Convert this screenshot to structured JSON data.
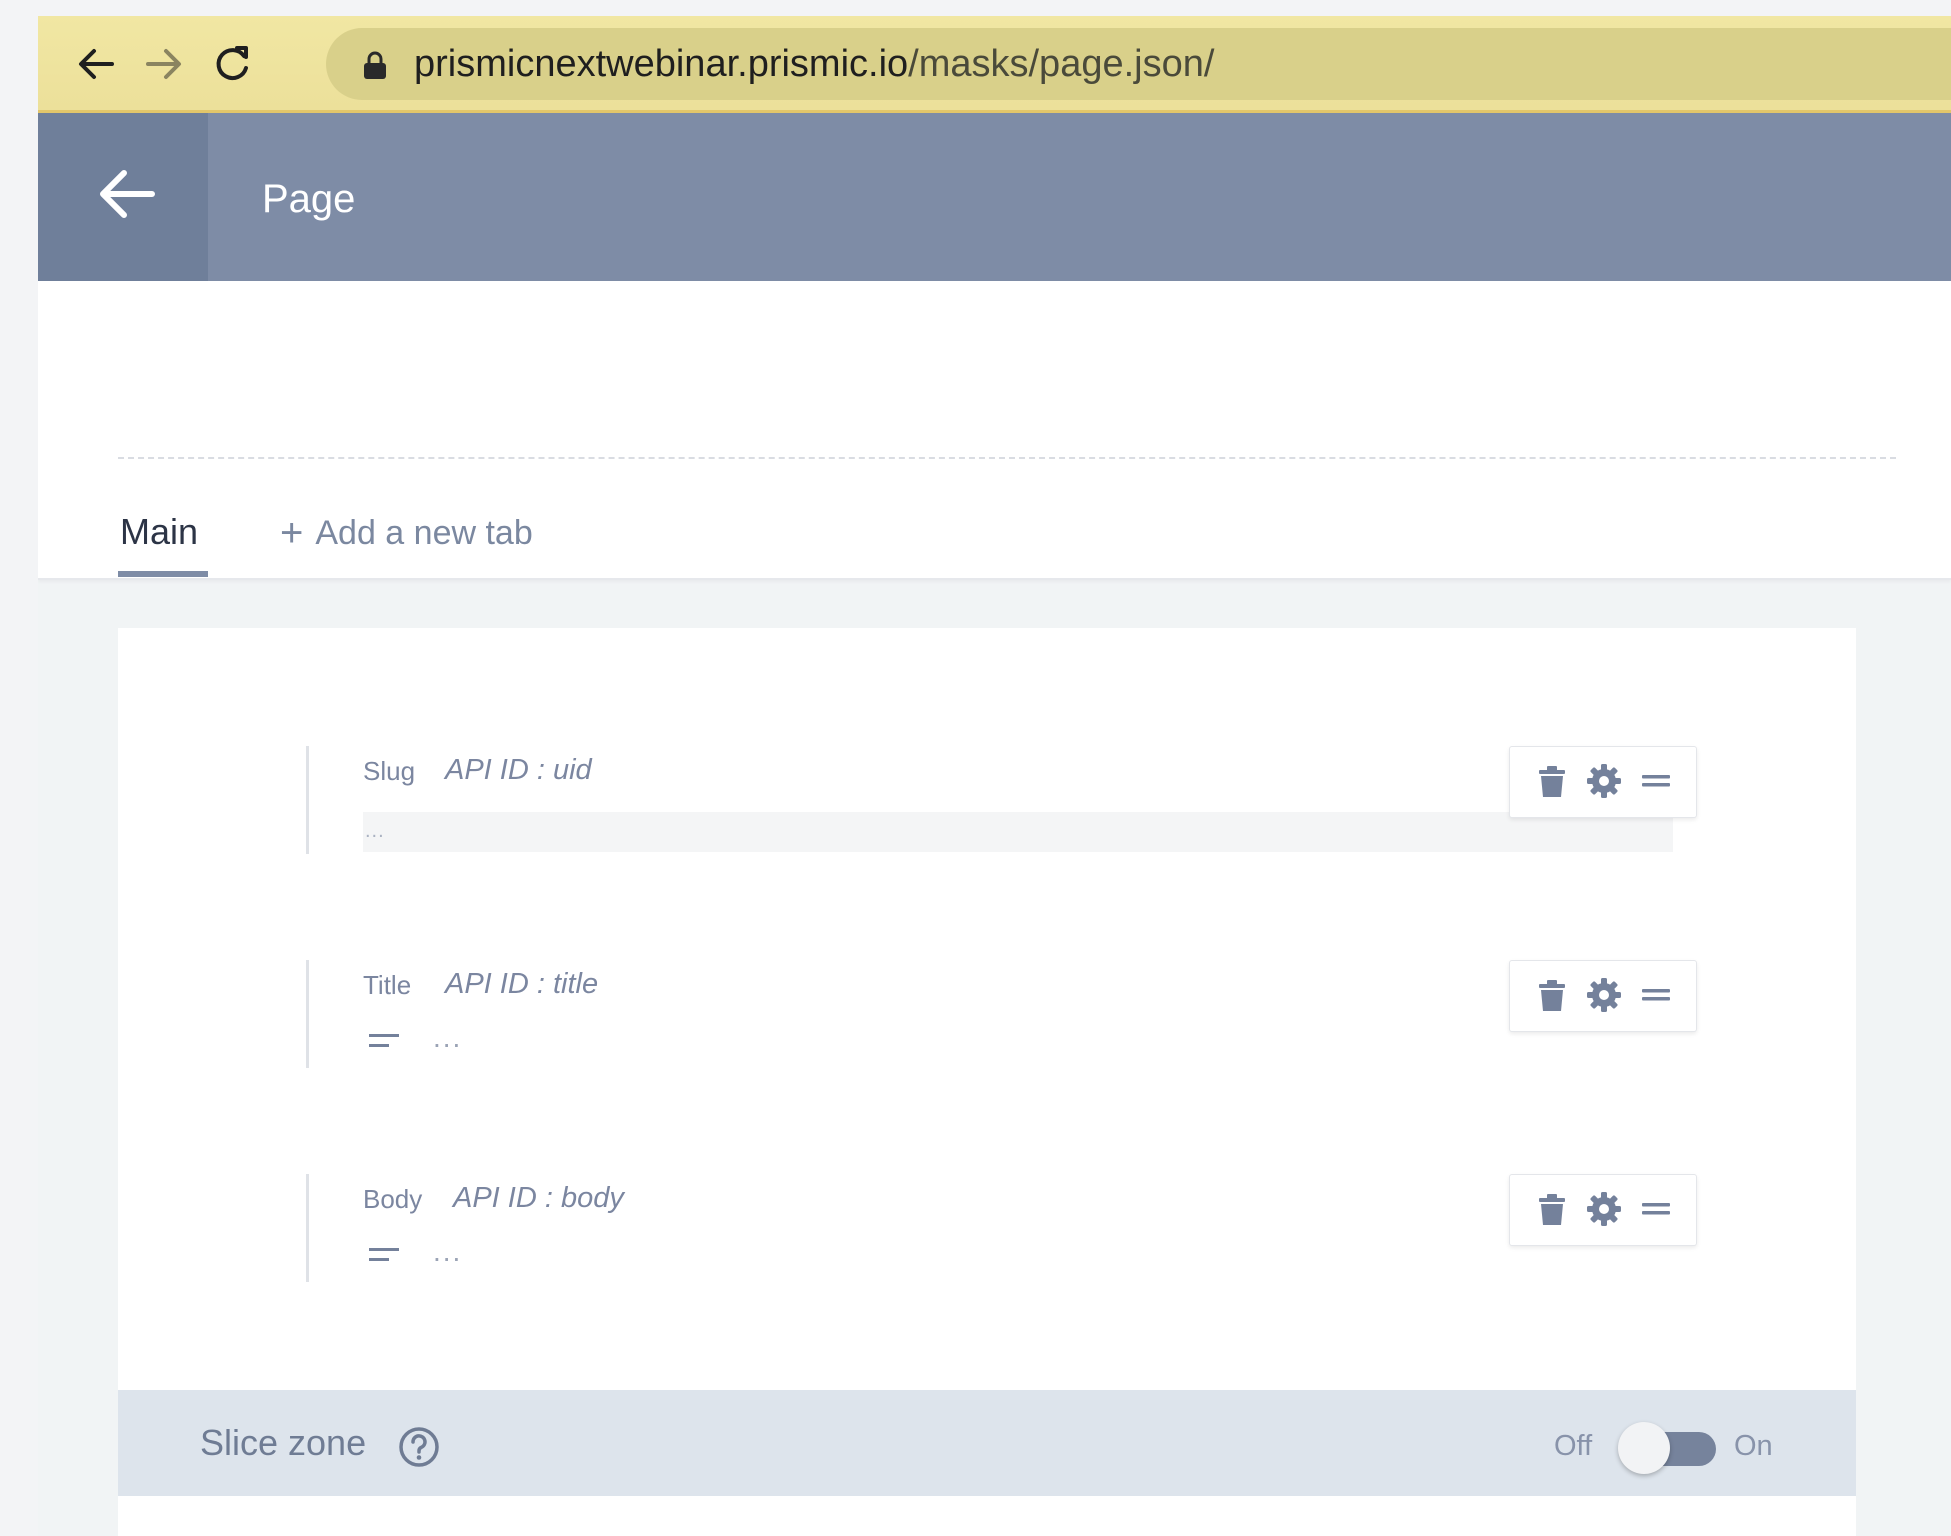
{
  "browser": {
    "url_host": "prismicnextwebinar.prismic.io",
    "url_path": "/masks/page.json/"
  },
  "header": {
    "title": "Page"
  },
  "tabs": {
    "main_label": "Main",
    "add_label": "Add a new tab"
  },
  "fields": [
    {
      "label": "Slug",
      "api_id": "API ID : uid",
      "placeholder": "..."
    },
    {
      "label": "Title",
      "api_id": "API ID : title",
      "placeholder": "..."
    },
    {
      "label": "Body",
      "api_id": "API ID : body",
      "placeholder": "..."
    }
  ],
  "slice_zone": {
    "title": "Slice zone",
    "off_label": "Off",
    "on_label": "On",
    "enabled": false
  },
  "colors": {
    "header_bg": "#7e8ca6",
    "browser_bar": "#efe4a0",
    "slice_zone_bg": "#dde4ec"
  }
}
